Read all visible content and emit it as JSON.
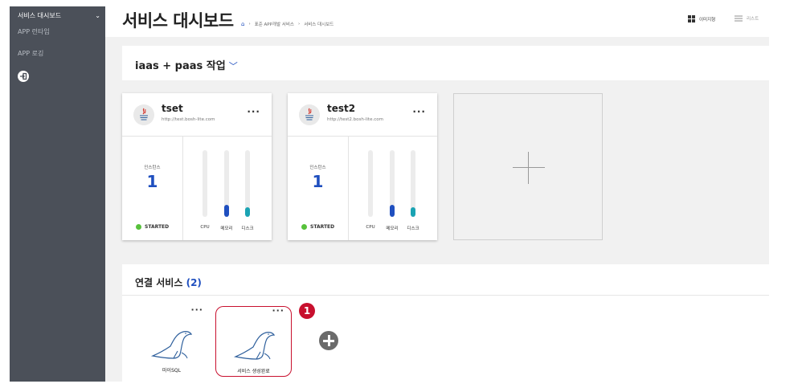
{
  "sidebar": {
    "header": "서비스 대시보드",
    "items": [
      {
        "label": "APP 런타임"
      },
      {
        "label": "APP 로깅"
      }
    ]
  },
  "header": {
    "title": "서비스 대시보드",
    "breadcrumb": [
      "표준 APP개발 서비스",
      "서비스 대시보드"
    ],
    "view_image": "이미지형",
    "view_list": "리스트"
  },
  "space": {
    "title": "iaas + paas 작업",
    "apps": [
      {
        "name": "tset",
        "url": "http://test.bosh-lite.com",
        "instances_label": "인스턴스",
        "instances": "1",
        "status": "STARTED",
        "metrics": [
          {
            "label": "CPU",
            "value": 0,
            "color": "#1f4fbf"
          },
          {
            "label": "메모리",
            "value": 0.18,
            "color": "#1f4fbf"
          },
          {
            "label": "디스크",
            "value": 0.15,
            "color": "#1aa3b3"
          }
        ]
      },
      {
        "name": "test2",
        "url": "http://test2.bosh-lite.com",
        "instances_label": "인스턴스",
        "instances": "1",
        "status": "STARTED",
        "metrics": [
          {
            "label": "CPU",
            "value": 0,
            "color": "#1f4fbf"
          },
          {
            "label": "메모리",
            "value": 0.18,
            "color": "#1f4fbf"
          },
          {
            "label": "디스크",
            "value": 0.15,
            "color": "#1aa3b3"
          }
        ]
      }
    ]
  },
  "services": {
    "title": "연결 서비스",
    "count": "(2)",
    "items": [
      {
        "label": "마이SQL"
      },
      {
        "label": "서비스 생성완료"
      }
    ],
    "badge": "1"
  },
  "icons": {
    "more": "more-icon",
    "java": "java-icon",
    "mysql": "mysql-seal-icon",
    "add": "add-icon"
  }
}
